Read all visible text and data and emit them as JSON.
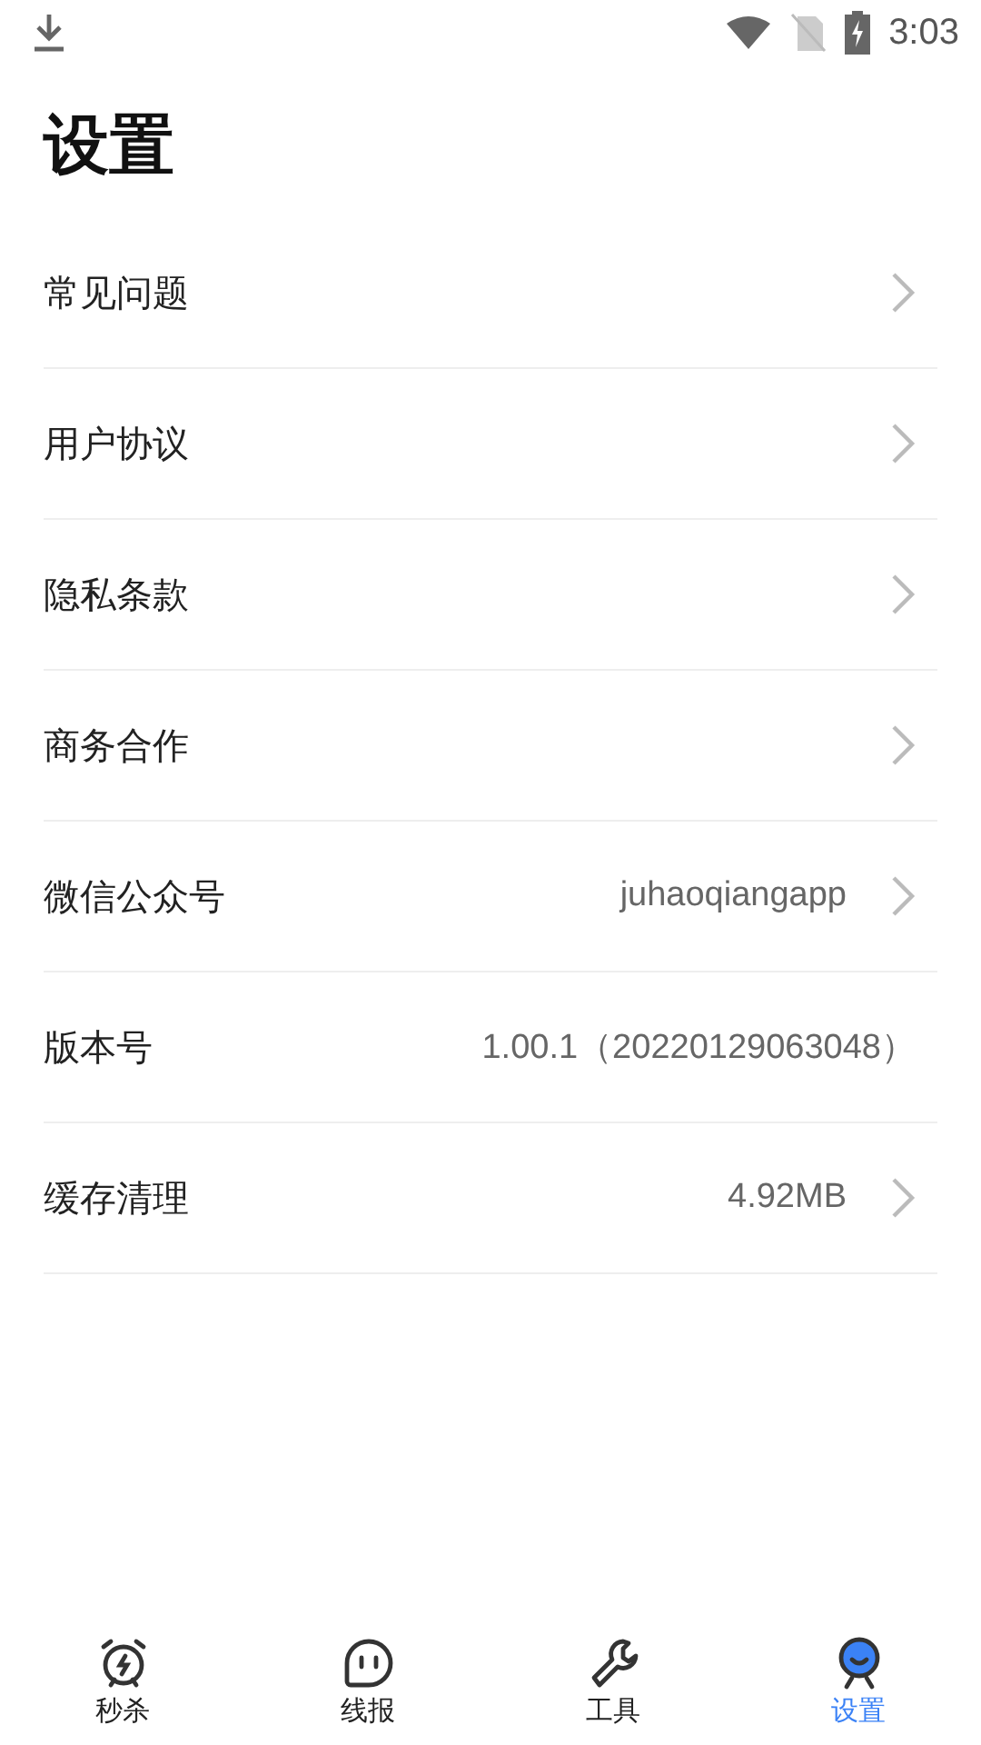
{
  "status_bar": {
    "time": "3:03"
  },
  "title": "设置",
  "items": [
    {
      "label": "常见问题",
      "chevron": true
    },
    {
      "label": "用户协议",
      "chevron": true
    },
    {
      "label": "隐私条款",
      "chevron": true
    },
    {
      "label": "商务合作",
      "chevron": true
    },
    {
      "label": "微信公众号",
      "value": "juhaoqiangapp",
      "chevron": true
    },
    {
      "label": "版本号",
      "value": "1.00.1（20220129063048）",
      "chevron": false
    },
    {
      "label": "缓存清理",
      "value": "4.92MB",
      "chevron": true
    }
  ],
  "tabs": [
    {
      "label": "秒杀",
      "kind": "alarm",
      "selected": false
    },
    {
      "label": "线报",
      "kind": "chat",
      "selected": false
    },
    {
      "label": "工具",
      "kind": "wrench",
      "selected": false
    },
    {
      "label": "设置",
      "kind": "user",
      "selected": true
    }
  ]
}
